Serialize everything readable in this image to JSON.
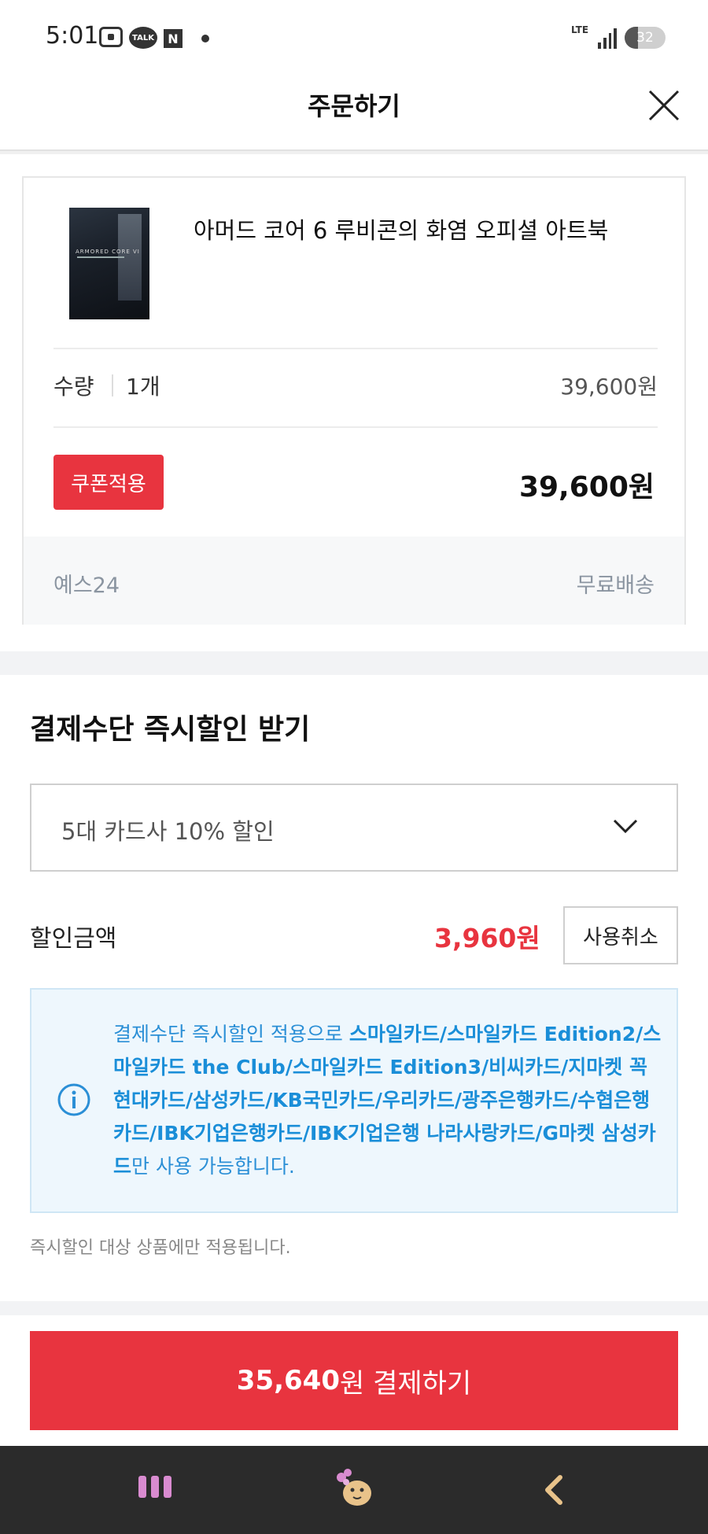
{
  "status_bar": {
    "time": "5:01",
    "talk_icon_text": "TALK",
    "n_icon_text": "N",
    "network": "LTE",
    "battery_percent": 32,
    "battery_label": "32"
  },
  "header": {
    "title": "주문하기",
    "close_icon": "close-icon"
  },
  "product": {
    "name": "아머드 코어 6 루비콘의 화염 오피셜 아트북",
    "thumbnail_icon": "book-cover-image",
    "quantity_label": "수량",
    "quantity_value": "1개",
    "unit_price": "39,600원",
    "coupon_button": "쿠폰적용",
    "total_price": "39,600원",
    "seller": "예스24",
    "shipping": "무료배송"
  },
  "payment_discount": {
    "title": "결제수단 즉시할인 받기",
    "selected_option": "5대 카드사 10% 할인",
    "discount_label": "할인금액",
    "discount_amount": "3,960원",
    "cancel_button": "사용취소",
    "info_prefix": "결제수단 즉시할인 적용으로 ",
    "info_cards": "스마일카드/스마일카드 Edition2/스마일카드 the Club/스마일카드 Edition3/비씨카드/지마켓 꼭 현대카드/삼성카드/KB국민카드/우리카드/광주은행카드/수협은행카드/IBK기업은행카드/IBK기업은행 나라사랑카드/G마켓 삼성카드",
    "info_suffix": "만 사용 가능합니다.",
    "note": "즉시할인 대상 상품에만 적용됩니다."
  },
  "checkout": {
    "amount": "35,640",
    "label": "원 결제하기"
  },
  "colors": {
    "accent_red": "#e8343f",
    "info_blue": "#1a8ed8",
    "info_bg": "#eef7fd",
    "nav_bg": "#2b2b2b"
  }
}
